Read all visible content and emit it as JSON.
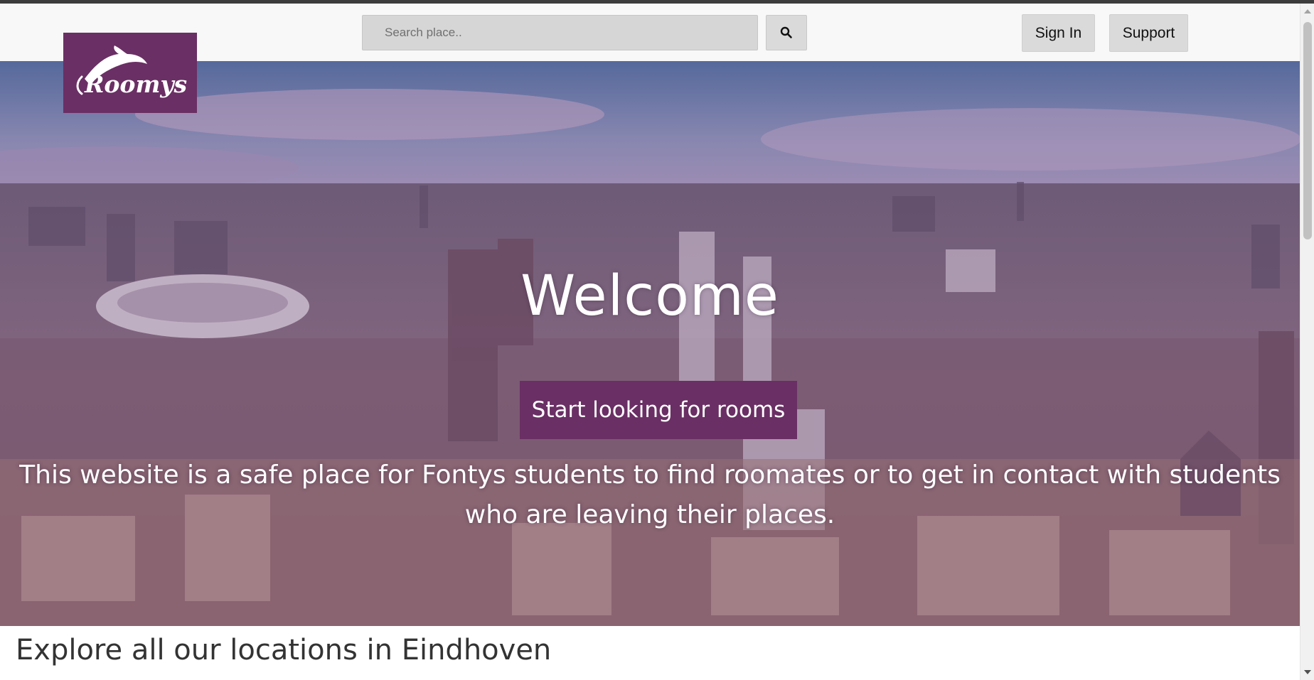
{
  "header": {
    "logo_text": "Roomys",
    "search_placeholder": "Search place..",
    "search_icon": "search-icon",
    "signin_label": "Sign In",
    "support_label": "Support"
  },
  "hero": {
    "welcome": "Welcome",
    "cta_label": "Start looking for rooms",
    "tagline_line1": "This website is a safe place for Fontys students to find roomates or to get in contact with students",
    "tagline_line2": "who are leaving their places."
  },
  "section": {
    "explore_title": "Explore all our locations in Eindhoven"
  },
  "colors": {
    "brand_purple": "#6a2f64",
    "navbar_bg": "#f8f8f8",
    "button_bg": "#dadada"
  }
}
